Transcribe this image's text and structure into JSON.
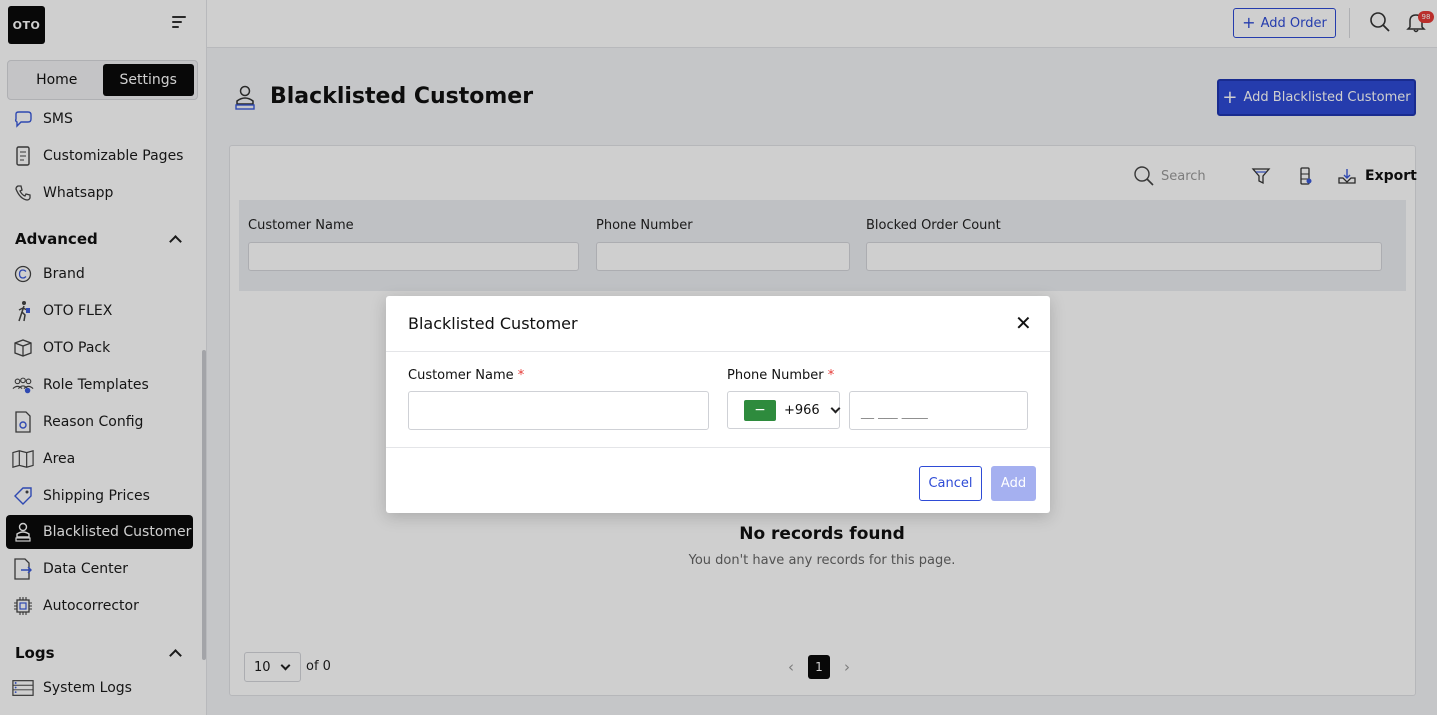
{
  "app": {
    "logo_text": "OTO"
  },
  "sidebar": {
    "tabs": [
      {
        "label": "Home",
        "active": false
      },
      {
        "label": "Settings",
        "active": true
      }
    ],
    "items_top": [
      {
        "label": "SMS",
        "icon": "chat-bubble-icon"
      },
      {
        "label": "Customizable Pages",
        "icon": "document-icon"
      },
      {
        "label": "Whatsapp",
        "icon": "phone-icon"
      }
    ],
    "advanced_header": "Advanced",
    "advanced_items": [
      {
        "label": "Brand",
        "icon": "copyright-icon"
      },
      {
        "label": "OTO FLEX",
        "icon": "walking-person-icon"
      },
      {
        "label": "OTO Pack",
        "icon": "box-icon"
      },
      {
        "label": "Role Templates",
        "icon": "users-icon"
      },
      {
        "label": "Reason Config",
        "icon": "file-gear-icon"
      },
      {
        "label": "Area",
        "icon": "map-icon"
      },
      {
        "label": "Shipping Prices",
        "icon": "price-tag-icon"
      },
      {
        "label": "Blacklisted Customer",
        "icon": "blocked-user-icon",
        "active": true
      },
      {
        "label": "Data Center",
        "icon": "data-file-icon"
      },
      {
        "label": "Autocorrector",
        "icon": "chip-icon"
      }
    ],
    "logs_header": "Logs",
    "logs_items": [
      {
        "label": "System Logs",
        "icon": "server-icon"
      }
    ]
  },
  "topbar": {
    "add_order_label": "Add Order",
    "notification_count": "98"
  },
  "page": {
    "title": "Blacklisted Customer",
    "add_button_label": "Add Blacklisted Customer"
  },
  "toolbar": {
    "search_placeholder": "Search",
    "export_label": "Export"
  },
  "filters": {
    "columns": [
      "Customer Name",
      "Phone Number",
      "Blocked Order Count"
    ]
  },
  "empty_state": {
    "title": "No records found",
    "subtitle": "You don't have any records for this page."
  },
  "pagination": {
    "page_size": "10",
    "of_text": "of 0",
    "current_page": "1"
  },
  "modal": {
    "title": "Blacklisted Customer",
    "customer_name_label": "Customer Name",
    "phone_label": "Phone Number",
    "required_mark": "*",
    "country_code": "+966",
    "phone_placeholder": "__ ___ ____",
    "cancel_label": "Cancel",
    "add_label": "Add"
  },
  "colors": {
    "accent": "#2e4bd6",
    "active_nav": "#0b0b0b",
    "required": "#e53935",
    "disabled_button": "#a5b0f0"
  }
}
